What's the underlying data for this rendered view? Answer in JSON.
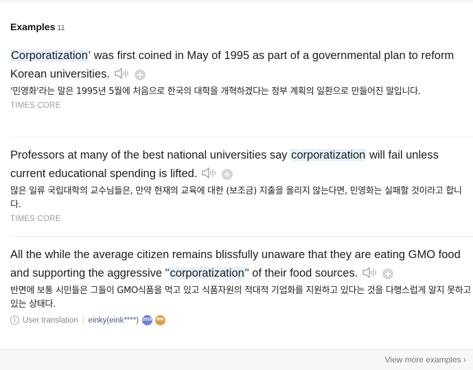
{
  "header": {
    "title": "Examples",
    "count": "11"
  },
  "examples": [
    {
      "en_highlight": "Corporatization",
      "en_after": "' was first coined in May of 1995 as part of a governmental plan to reform Korean universities.",
      "ko": "'민영화'라는 말은 1995년 5월에 처음으로 한국의 대학을 개혁하겠다는 정부 계획의 일환으로 만들어진 말입니다.",
      "source": "TIMES CORE"
    },
    {
      "en_before": "Professors at many of the best national universities say ",
      "en_highlight": "corporatization",
      "en_after": " will fail unless current educational spending is lifted.",
      "ko": "많은 일류 국립대학의 교수님들은, 만약 현재의 교육에 대한 (보조금) 지출을 올리지 않는다면, 민영화는 실패할 것이라고 합니다.",
      "source": "TIMES CORE"
    },
    {
      "en_before": "All the while the average citizen remains blissfully unaware that they are eating GMO food and supporting the aggressive \"",
      "en_highlight": "corporatization",
      "en_after": "\" of their food sources.",
      "ko": "반면에 보통 시민들은 그들이 GMO식품을 먹고 있고 식품자원의 적대적 기업화를 지원하고 있다는 것을 다행스럽게 알지 못하고 있는 상태다.",
      "user_translation_label": "User translation",
      "user_name": "einky(eink****)",
      "badge1": "2019",
      "badge2": "99K"
    }
  ],
  "footer": {
    "view_more": "View more examples"
  },
  "icons": {
    "speaker": "speaker-icon",
    "add": "add-icon",
    "info": "info-icon",
    "chevron": "chevron-right-icon"
  },
  "colors": {
    "highlight": "#e6f1fa",
    "badge_blue": "#6d7fd6",
    "badge_gold": "#d9a04e"
  }
}
